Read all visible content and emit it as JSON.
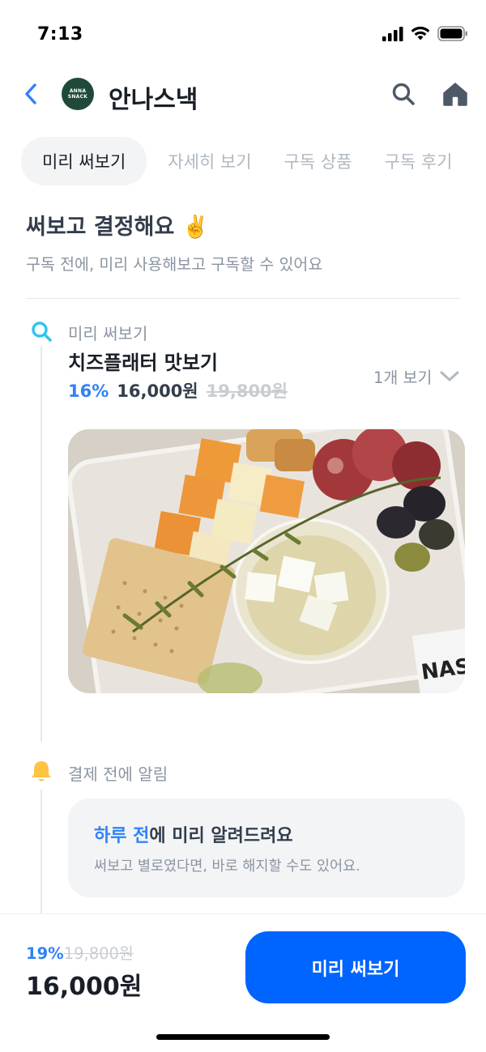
{
  "status_bar": {
    "time": "7:13"
  },
  "header": {
    "brand_name": "안나스낵",
    "logo_line1": "ANNA",
    "logo_line2": "SNACK",
    "icons": [
      "chevron-left-icon",
      "search-icon",
      "home-icon"
    ]
  },
  "tabs": [
    {
      "label": "미리 써보기",
      "active": true
    },
    {
      "label": "자세히 보기",
      "active": false
    },
    {
      "label": "구독 상품",
      "active": false
    },
    {
      "label": "구독 후기",
      "active": false
    }
  ],
  "intro": {
    "title": "써보고 결정해요 ✌️",
    "subtitle": "구독 전에, 미리 사용해보고 구독할 수 있어요"
  },
  "steps": {
    "preview": {
      "label": "미리 써보기",
      "product_name": "치즈플래터 맛보기",
      "discount": "16%",
      "price": "16,000원",
      "original_price": "19,800원",
      "view_toggle": "1개 보기"
    },
    "notify": {
      "label": "결제 전에 알림",
      "title_highlight": "하루 전",
      "title_rest": "에 미리 알려드려요",
      "description": "써보고 별로였다면, 바로 해지할 수도 있어요."
    }
  },
  "bottom_bar": {
    "discount": "19%",
    "original_price": "19,800원",
    "price": "16,000원",
    "cta_label": "미리 써보기"
  },
  "colors": {
    "accent": "#3182f6",
    "cta": "#0064ff",
    "notify_bell": "#ffc342",
    "search_step": "#2fc4f0"
  }
}
